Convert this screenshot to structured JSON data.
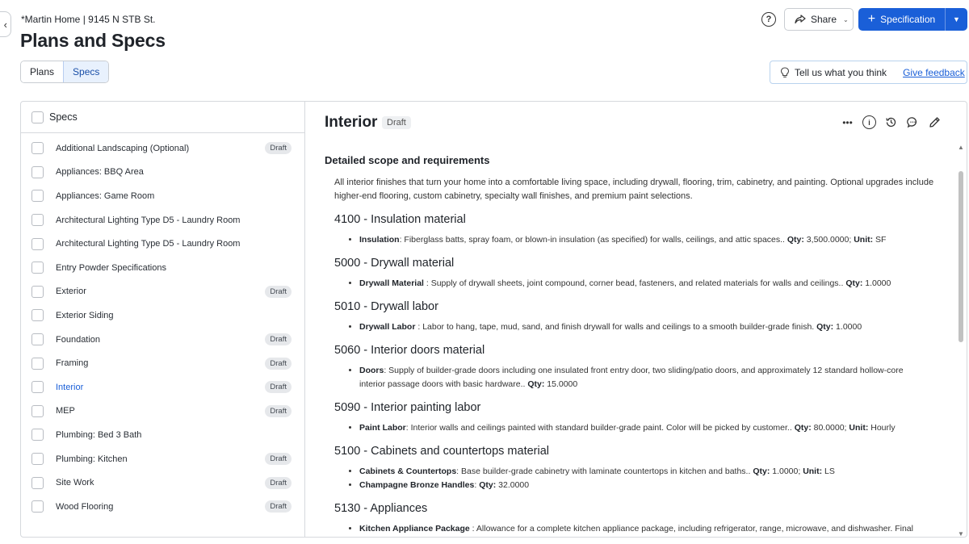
{
  "header": {
    "project": "*Martin Home | 9145 N STB St.",
    "title": "Plans and Specs",
    "share_label": "Share",
    "spec_button_label": "Specification",
    "feedback_text": "Tell us what you think",
    "feedback_link": "Give feedback"
  },
  "tabs": [
    {
      "label": "Plans",
      "active": false
    },
    {
      "label": "Specs",
      "active": true
    }
  ],
  "specs_panel": {
    "header": "Specs",
    "items": [
      {
        "label": "Additional Landscaping (Optional)",
        "badge": "Draft"
      },
      {
        "label": "Appliances: BBQ Area",
        "badge": ""
      },
      {
        "label": "Appliances: Game Room",
        "badge": ""
      },
      {
        "label": "Architectural Lighting Type D5 - Laundry Room",
        "badge": ""
      },
      {
        "label": "Architectural Lighting Type D5 - Laundry Room",
        "badge": ""
      },
      {
        "label": "Entry Powder Specifications",
        "badge": ""
      },
      {
        "label": "Exterior",
        "badge": "Draft"
      },
      {
        "label": "Exterior Siding",
        "badge": ""
      },
      {
        "label": "Foundation",
        "badge": "Draft"
      },
      {
        "label": "Framing",
        "badge": "Draft"
      },
      {
        "label": "Interior",
        "badge": "Draft",
        "active": true
      },
      {
        "label": "MEP",
        "badge": "Draft"
      },
      {
        "label": "Plumbing: Bed 3 Bath",
        "badge": ""
      },
      {
        "label": "Plumbing: Kitchen",
        "badge": "Draft"
      },
      {
        "label": "Site Work",
        "badge": "Draft"
      },
      {
        "label": "Wood Flooring",
        "badge": "Draft"
      }
    ]
  },
  "detail": {
    "title": "Interior",
    "status": "Draft",
    "section_heading": "Detailed scope and requirements",
    "description": "All interior finishes that turn your home into a comfortable living space, including drywall, flooring, trim, cabinetry, and painting. Optional upgrades include higher-end flooring, custom cabinetry, specialty wall finishes, and premium paint selections.",
    "codes": [
      {
        "heading": "4100 - Insulation material",
        "items": [
          {
            "name": "Insulation",
            "text": ": Fiberglass batts, spray foam, or blown-in insulation (as specified) for walls, ceilings, and attic spaces.. ",
            "qty_label": "Qty:",
            "qty": " 3,500.0000; ",
            "unit_label": "Unit:",
            "unit": " SF"
          }
        ]
      },
      {
        "heading": "5000 - Drywall material",
        "items": [
          {
            "name": "Drywall Material",
            "text": " : Supply of drywall sheets, joint compound, corner bead, fasteners, and related materials for walls and ceilings.. ",
            "qty_label": "Qty:",
            "qty": " 1.0000",
            "unit_label": "",
            "unit": ""
          }
        ]
      },
      {
        "heading": "5010 - Drywall labor",
        "items": [
          {
            "name": "Drywall Labor",
            "text": " : Labor to hang, tape, mud, sand, and finish drywall for walls and ceilings to a smooth builder-grade finish. ",
            "qty_label": "Qty:",
            "qty": " 1.0000",
            "unit_label": "",
            "unit": ""
          }
        ]
      },
      {
        "heading": "5060 - Interior doors material",
        "items": [
          {
            "name": "Doors",
            "text": ": Supply of builder-grade doors including one insulated front entry door, two sliding/patio doors, and approximately 12 standard hollow-core interior passage doors with basic hardware.. ",
            "qty_label": "Qty:",
            "qty": " 15.0000",
            "unit_label": "",
            "unit": ""
          }
        ]
      },
      {
        "heading": "5090 - Interior painting labor",
        "items": [
          {
            "name": "Paint Labor",
            "text": ": Interior walls and ceilings painted with standard builder-grade paint. Color will be picked by customer.. ",
            "qty_label": "Qty:",
            "qty": " 80.0000; ",
            "unit_label": "Unit:",
            "unit": " Hourly"
          }
        ]
      },
      {
        "heading": "5100 - Cabinets and countertops material",
        "items": [
          {
            "name": "Cabinets & Countertops",
            "text": ": Base builder-grade cabinetry with laminate countertops in kitchen and baths.. ",
            "qty_label": "Qty:",
            "qty": " 1.0000; ",
            "unit_label": "Unit:",
            "unit": " LS"
          },
          {
            "name": "Champagne Bronze Handles",
            "text": ": ",
            "qty_label": "Qty:",
            "qty": " 32.0000",
            "unit_label": "",
            "unit": ""
          }
        ]
      },
      {
        "heading": "5130 - Appliances",
        "items": [
          {
            "name": "Kitchen Appliance Package",
            "text": " : Allowance for a complete kitchen appliance package, including refrigerator, range, microwave, and dishwasher. Final",
            "qty_label": "",
            "qty": "",
            "unit_label": "",
            "unit": ""
          }
        ]
      }
    ]
  },
  "colors": {
    "primary": "#1a5fd8",
    "active_tab_bg": "#e8f1fd",
    "badge_bg": "#e6e8eb"
  },
  "icons": [
    "chevron-left-icon",
    "help-icon",
    "share-icon",
    "chevron-down-icon",
    "plus-icon",
    "lightbulb-icon",
    "more-icon",
    "info-icon",
    "history-icon",
    "comment-icon",
    "edit-icon"
  ]
}
